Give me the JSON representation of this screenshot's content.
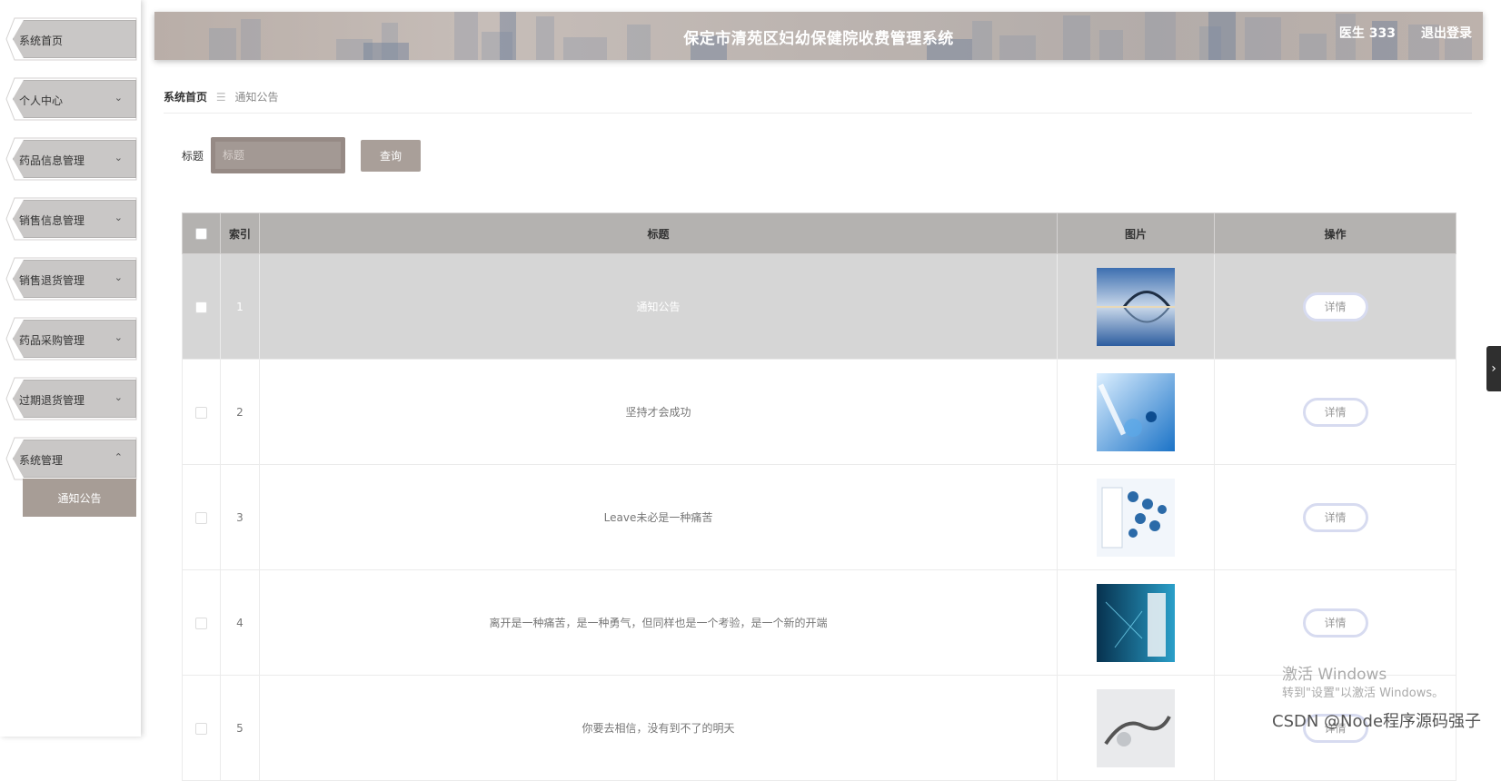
{
  "app": {
    "title": "保定市清苑区妇幼保健院收费管理系统",
    "user": "医生 333",
    "logout": "退出登录"
  },
  "sidebar": {
    "items": [
      {
        "label": "系统首页",
        "has_arrow": false
      },
      {
        "label": "个人中心",
        "has_arrow": true,
        "arrow": "⌄"
      },
      {
        "label": "药品信息管理",
        "has_arrow": true,
        "arrow": "⌄"
      },
      {
        "label": "销售信息管理",
        "has_arrow": true,
        "arrow": "⌄"
      },
      {
        "label": "销售退货管理",
        "has_arrow": true,
        "arrow": "⌄"
      },
      {
        "label": "药品采购管理",
        "has_arrow": true,
        "arrow": "⌄"
      },
      {
        "label": "过期退货管理",
        "has_arrow": true,
        "arrow": "⌄"
      },
      {
        "label": "系统管理",
        "has_arrow": true,
        "arrow": "⌃"
      }
    ],
    "submenu": {
      "label": "通知公告",
      "active": true
    }
  },
  "breadcrumb": {
    "home": "系统首页",
    "separator": "☰",
    "current": "通知公告"
  },
  "search": {
    "label": "标题",
    "placeholder": "标题",
    "value": "",
    "button": "查询"
  },
  "table": {
    "headers": [
      "",
      "索引",
      "标题",
      "图片",
      "操作"
    ],
    "rows": [
      {
        "index": "1",
        "title": "通知公告",
        "action": "详情",
        "image": "bridge-lake",
        "selected": true
      },
      {
        "index": "2",
        "title": "坚持才会成功",
        "action": "详情",
        "image": "lab-pipette",
        "selected": false
      },
      {
        "index": "3",
        "title": "Leave未必是一种痛苦",
        "action": "详情",
        "image": "medical-icons",
        "selected": false
      },
      {
        "index": "4",
        "title": "离开是一种痛苦，是一种勇气，但同样也是一个考验，是一个新的开端",
        "action": "详情",
        "image": "doctor-tech",
        "selected": false
      },
      {
        "index": "5",
        "title": "你要去相信，没有到不了的明天",
        "action": "详情",
        "image": "robot-hand",
        "selected": false
      }
    ]
  },
  "side_toggle": "›",
  "watermark": {
    "line1": "激活 Windows",
    "line2": "转到\"设置\"以激活 Windows。",
    "credit": "CSDN @Node程序源码强子"
  },
  "colors": {
    "header_bg": "#b9aea8",
    "menu_bg": "#c9c7c6",
    "submenu_active": "#a79d96",
    "search_btn": "#a99f99",
    "table_header": "#b4b2b0",
    "detail_border": "#d7dbf0"
  }
}
